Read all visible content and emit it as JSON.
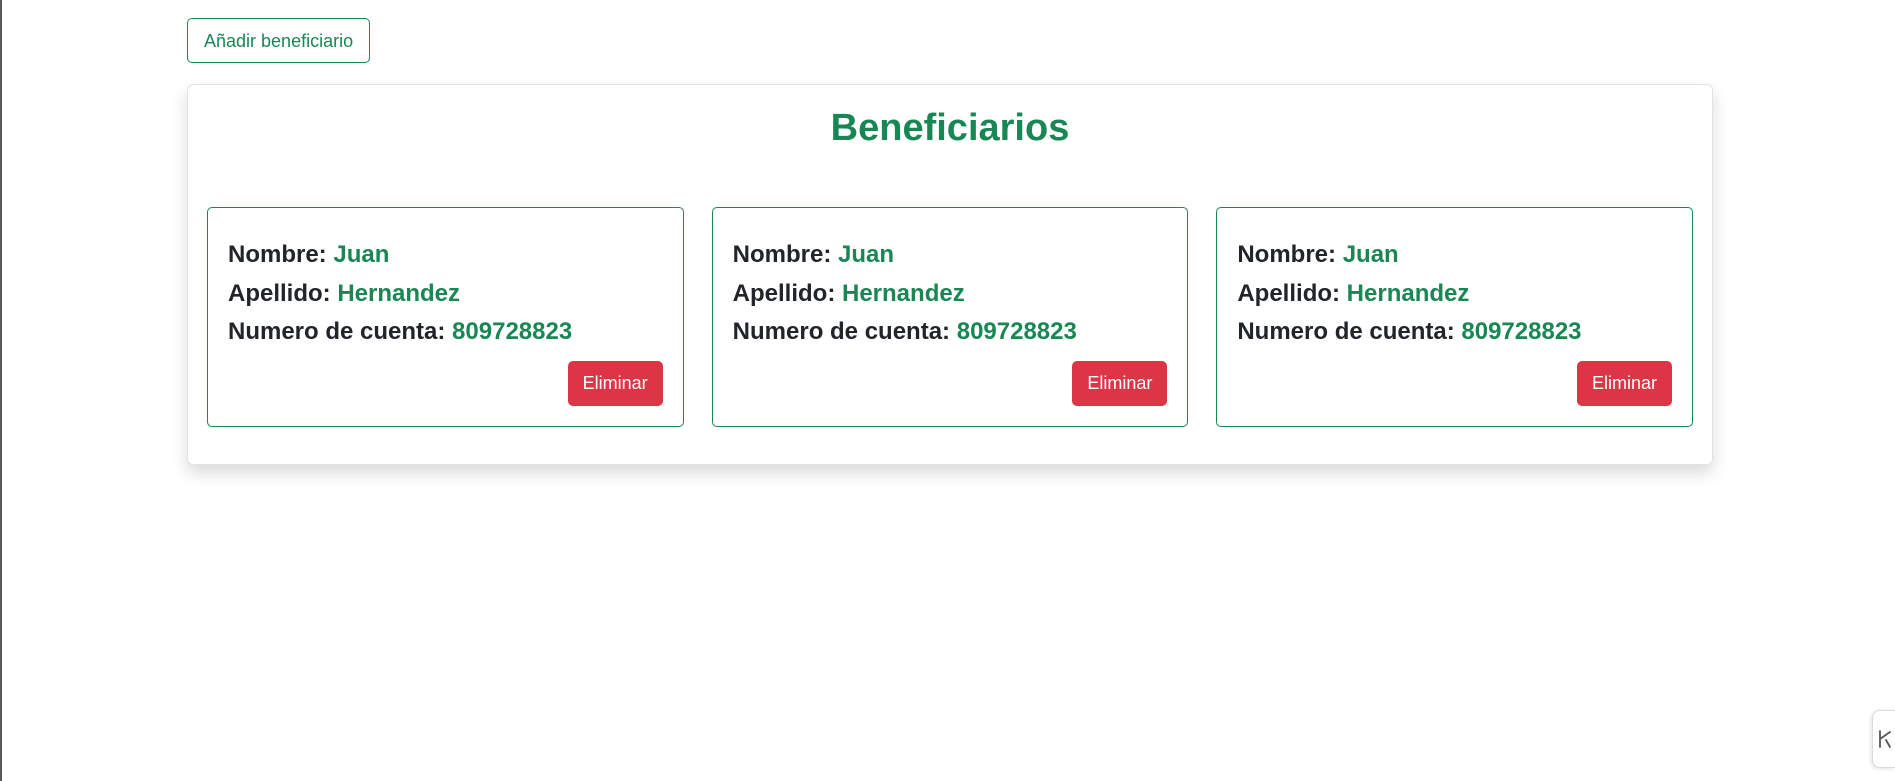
{
  "toolbar": {
    "add_label": "Añadir beneficiario"
  },
  "panel": {
    "title": "Beneficiarios"
  },
  "labels": {
    "nombre": "Nombre:",
    "apellido": "Apellido:",
    "cuenta": "Numero de cuenta:",
    "delete": "Eliminar"
  },
  "beneficiarios": [
    {
      "nombre": "Juan",
      "apellido": "Hernandez",
      "cuenta": "809728823"
    },
    {
      "nombre": "Juan",
      "apellido": "Hernandez",
      "cuenta": "809728823"
    },
    {
      "nombre": "Juan",
      "apellido": "Hernandez",
      "cuenta": "809728823"
    }
  ],
  "colors": {
    "primary_green": "#198754",
    "danger_red": "#dc3545",
    "text_dark": "#212529"
  },
  "icons": {
    "corner_widget": "collapse-icon"
  }
}
